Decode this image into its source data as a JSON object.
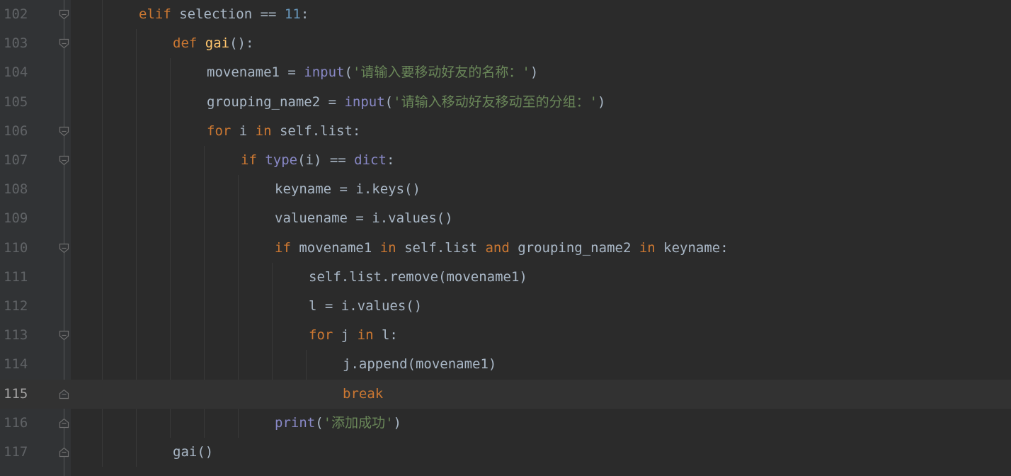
{
  "editor": {
    "lines": [
      {
        "num": "102",
        "tokens": [
          [
            "kw",
            "elif"
          ],
          [
            "id",
            " selection == "
          ],
          [
            "num",
            "11"
          ],
          [
            "id",
            ":"
          ]
        ]
      },
      {
        "num": "103",
        "tokens": [
          [
            "kw",
            "def "
          ],
          [
            "fn",
            "gai"
          ],
          [
            "id",
            "():"
          ]
        ]
      },
      {
        "num": "104",
        "tokens": [
          [
            "id",
            "movename1 = "
          ],
          [
            "bi",
            "input"
          ],
          [
            "id",
            "("
          ],
          [
            "str",
            "'请输入要移动好友的名称：'"
          ],
          [
            "id",
            ")"
          ]
        ]
      },
      {
        "num": "105",
        "tokens": [
          [
            "id",
            "grouping_name2 = "
          ],
          [
            "bi",
            "input"
          ],
          [
            "id",
            "("
          ],
          [
            "str",
            "'请输入移动好友移动至的分组：'"
          ],
          [
            "id",
            ")"
          ]
        ]
      },
      {
        "num": "106",
        "tokens": [
          [
            "kw",
            "for"
          ],
          [
            "id",
            " i "
          ],
          [
            "kw",
            "in"
          ],
          [
            "id",
            " self.list:"
          ]
        ]
      },
      {
        "num": "107",
        "tokens": [
          [
            "kw",
            "if "
          ],
          [
            "bi",
            "type"
          ],
          [
            "id",
            "(i) == "
          ],
          [
            "bi",
            "dict"
          ],
          [
            "id",
            ":"
          ]
        ]
      },
      {
        "num": "108",
        "tokens": [
          [
            "id",
            "keyname = i.keys()"
          ]
        ]
      },
      {
        "num": "109",
        "tokens": [
          [
            "id",
            "valuename = i.values()"
          ]
        ]
      },
      {
        "num": "110",
        "tokens": [
          [
            "kw",
            "if"
          ],
          [
            "id",
            " movename1 "
          ],
          [
            "kw",
            "in"
          ],
          [
            "id",
            " self.list "
          ],
          [
            "kw",
            "and"
          ],
          [
            "id",
            " grouping_name2 "
          ],
          [
            "kw",
            "in"
          ],
          [
            "id",
            " keyname:"
          ]
        ]
      },
      {
        "num": "111",
        "tokens": [
          [
            "id",
            "self.list.remove(movename1)"
          ]
        ]
      },
      {
        "num": "112",
        "tokens": [
          [
            "id",
            "l = i.values()"
          ]
        ]
      },
      {
        "num": "113",
        "tokens": [
          [
            "kw",
            "for"
          ],
          [
            "id",
            " j "
          ],
          [
            "kw",
            "in"
          ],
          [
            "id",
            " l:"
          ]
        ]
      },
      {
        "num": "114",
        "tokens": [
          [
            "id",
            "j.append(movename1)"
          ]
        ]
      },
      {
        "num": "115",
        "tokens": [
          [
            "kw",
            "break"
          ]
        ]
      },
      {
        "num": "116",
        "tokens": [
          [
            "bi",
            "print"
          ],
          [
            "id",
            "("
          ],
          [
            "str",
            "'添加成功'"
          ],
          [
            "id",
            ")"
          ]
        ]
      },
      {
        "num": "117",
        "tokens": [
          [
            "id",
            "gai()"
          ]
        ]
      }
    ],
    "current_line": "115"
  },
  "colors": {
    "background": "#2b2b2b",
    "gutter": "#313335",
    "keyword": "#cc7832",
    "function": "#ffc66d",
    "builtin": "#8888c6",
    "number": "#6897bb",
    "string": "#6a8759",
    "identifier": "#a9b7c6"
  }
}
